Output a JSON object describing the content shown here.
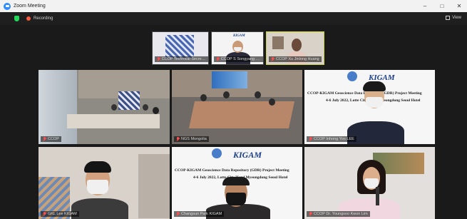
{
  "window": {
    "title": "Zoom Meeting"
  },
  "window_controls": {
    "minimize": "–",
    "maximize": "□",
    "close": "✕"
  },
  "infobar": {
    "recording_label": "Recording",
    "view_label": "View"
  },
  "thumbnails": [
    {
      "name": "CCOP Technical Secretariat"
    },
    {
      "name": "CCOP S Songyang Kim"
    },
    {
      "name": "CCOP Xu Jinlong Huang"
    }
  ],
  "tiles": [
    {
      "name": "CCOP"
    },
    {
      "name": "NGS Mongolia"
    },
    {
      "name": "CCOP Inhong Yoo LEE"
    },
    {
      "name": "GKL Lee KIGAM"
    },
    {
      "name": "Changsun Park KIGAM"
    },
    {
      "name": "CCOP Dr. Youngsoo Kwon Lim"
    }
  ],
  "slide": {
    "logo": "KIGAM",
    "line1": "CCOP-KIGAM Geoscience Data Repository (GDR) Project Meeting",
    "line2": "4-6 July 2022, Lotte City Hotel Myeongdong Seoul Hotel"
  },
  "icons": [
    "zoom-icon",
    "shield-icon",
    "record-icon",
    "view-grid-icon",
    "mic-muted-icon"
  ],
  "colors": {
    "accent": "#2d8cff",
    "recording": "#ff5a3c",
    "secure": "#23d959",
    "active_speaker": "#c9d43a"
  }
}
